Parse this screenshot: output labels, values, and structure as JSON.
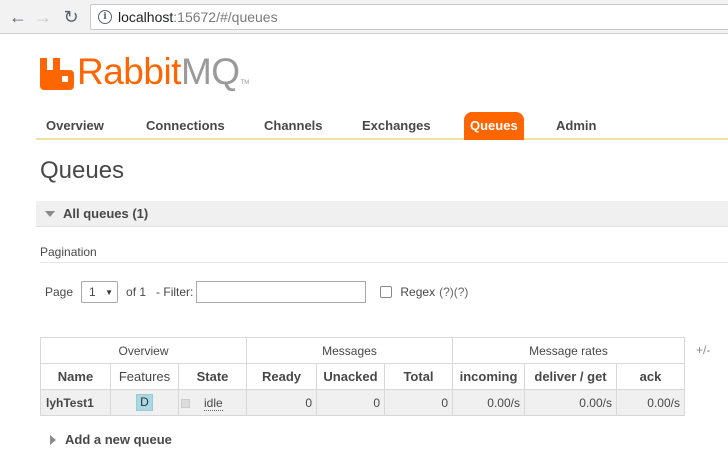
{
  "browser": {
    "url_host": "localhost",
    "url_path": ":15672/#/queues"
  },
  "logo": {
    "brand_a": "Rabbit",
    "brand_b": "MQ",
    "tm": "TM",
    "accent_color": "#ff6600"
  },
  "menu": {
    "items": [
      {
        "label": "Overview"
      },
      {
        "label": "Connections"
      },
      {
        "label": "Channels"
      },
      {
        "label": "Exchanges"
      },
      {
        "label": "Queues"
      },
      {
        "label": "Admin"
      }
    ],
    "active": "Queues"
  },
  "page": {
    "title": "Queues",
    "section_title": "All queues (1)",
    "pagination_label": "Pagination",
    "page_label": "Page",
    "page_value": "1",
    "of_label": "of 1",
    "filter_label": "- Filter:",
    "filter_value": "",
    "regex_label": "Regex",
    "regex_help": "(?)(?)",
    "plus_minus": "+/-",
    "add_queue": "Add a new queue"
  },
  "table": {
    "groups": [
      "Overview",
      "Messages",
      "Message rates"
    ],
    "columns": [
      "Name",
      "Features",
      "State",
      "Ready",
      "Unacked",
      "Total",
      "incoming",
      "deliver / get",
      "ack"
    ],
    "rows": [
      {
        "name": "lyhTest1",
        "feature": "D",
        "state": "idle",
        "ready": "0",
        "unacked": "0",
        "total": "0",
        "incoming": "0.00/s",
        "deliver_get": "0.00/s",
        "ack": "0.00/s"
      }
    ]
  }
}
